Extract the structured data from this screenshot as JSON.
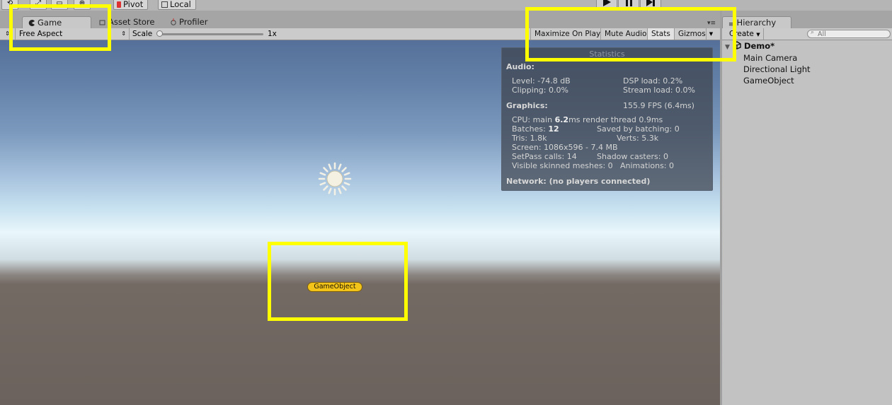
{
  "toolbar": {
    "pivot_label": "Pivot",
    "local_label": "Local"
  },
  "game_window": {
    "tabs": [
      {
        "label": "Game",
        "icon": "pacman-icon"
      },
      {
        "label": "Asset Store",
        "icon": "store-icon"
      },
      {
        "label": "Profiler",
        "icon": "profiler-icon"
      }
    ],
    "aspect_select": "Free Aspect",
    "scale_label": "Scale",
    "scale_value": "1x",
    "scale_level": 0,
    "buttons": {
      "maximize_on_play": "Maximize On Play",
      "mute_audio": "Mute Audio",
      "stats": "Stats",
      "gizmos": "Gizmos"
    }
  },
  "stats": {
    "title": "Statistics",
    "audio_header": "Audio:",
    "level": "Level: -74.8 dB",
    "clipping": "Clipping: 0.0%",
    "dsp_load": "DSP load: 0.2%",
    "stream_load": "Stream load: 0.0%",
    "graphics_header": "Graphics:",
    "fps": "155.9 FPS (6.4ms)",
    "cpu_prefix": "CPU: main ",
    "cpu_main": "6.2",
    "cpu_suffix": "ms  render thread 0.9ms",
    "batches_prefix": "Batches: ",
    "batches": "12",
    "saved_by_batching": "Saved by batching: 0",
    "tris": "Tris: 1.8k",
    "verts": "Verts: 5.3k",
    "screen": "Screen: 1086x596 - 7.4 MB",
    "setpass": "SetPass calls: 14",
    "shadow_casters": "Shadow casters: 0",
    "skinned_meshes": "Visible skinned meshes: 0",
    "animations": "Animations: 0",
    "network": "Network: (no players connected)"
  },
  "scene": {
    "gameobject_label": "GameObject"
  },
  "hierarchy": {
    "tab_label": "Hierarchy",
    "create_label": "Create",
    "search_placeholder": "All",
    "scene_name": "Demo*",
    "items": [
      "Main Camera",
      "Directional Light",
      "GameObject"
    ]
  },
  "colors": {
    "highlight": "#ffff00",
    "label_pill": "#f2c318"
  }
}
